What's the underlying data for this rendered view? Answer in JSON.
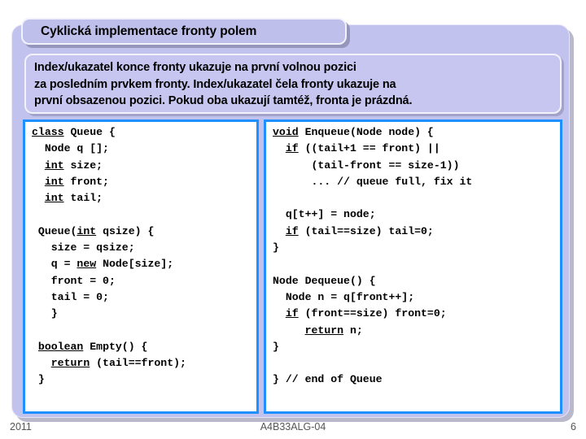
{
  "slide": {
    "title": "Cyklická implementace fronty polem",
    "body": "Index/ukazatel konce fronty ukazuje na první volnou pozici\nza posledním prvkem fronty. Index/ukazatel čela fronty ukazuje na\nprvní obsazenou pozici. Pokud oba ukazují tamtéž, fronta je prázdná."
  },
  "code": {
    "left_lines": [
      {
        "indent": 0,
        "parts": [
          {
            "t": "class",
            "kw": true
          },
          {
            "t": " Queue {",
            "kw": false
          }
        ]
      },
      {
        "indent": 0,
        "parts": [
          {
            "t": "  Node q [];",
            "kw": false
          }
        ]
      },
      {
        "indent": 0,
        "parts": [
          {
            "t": "  ",
            "kw": false
          },
          {
            "t": "int",
            "kw": true
          },
          {
            "t": " size;",
            "kw": false
          }
        ]
      },
      {
        "indent": 0,
        "parts": [
          {
            "t": "  ",
            "kw": false
          },
          {
            "t": "int",
            "kw": true
          },
          {
            "t": " front;",
            "kw": false
          }
        ]
      },
      {
        "indent": 0,
        "parts": [
          {
            "t": "  ",
            "kw": false
          },
          {
            "t": "int",
            "kw": true
          },
          {
            "t": " tail;",
            "kw": false
          }
        ]
      },
      {
        "indent": 0,
        "parts": [
          {
            "t": "",
            "kw": false
          }
        ]
      },
      {
        "indent": 0,
        "parts": [
          {
            "t": " Queue(",
            "kw": false
          },
          {
            "t": "int",
            "kw": true
          },
          {
            "t": " qsize) {",
            "kw": false
          }
        ]
      },
      {
        "indent": 0,
        "parts": [
          {
            "t": "   size = qsize;",
            "kw": false
          }
        ]
      },
      {
        "indent": 0,
        "parts": [
          {
            "t": "   q = ",
            "kw": false
          },
          {
            "t": "new",
            "kw": true
          },
          {
            "t": " Node[size];",
            "kw": false
          }
        ]
      },
      {
        "indent": 0,
        "parts": [
          {
            "t": "   front = 0;",
            "kw": false
          }
        ]
      },
      {
        "indent": 0,
        "parts": [
          {
            "t": "   tail = 0;",
            "kw": false
          }
        ]
      },
      {
        "indent": 0,
        "parts": [
          {
            "t": "   }",
            "kw": false
          }
        ]
      },
      {
        "indent": 0,
        "parts": [
          {
            "t": "",
            "kw": false
          }
        ]
      },
      {
        "indent": 0,
        "parts": [
          {
            "t": " ",
            "kw": false
          },
          {
            "t": "boolean",
            "kw": true
          },
          {
            "t": " Empty() {",
            "kw": false
          }
        ]
      },
      {
        "indent": 0,
        "parts": [
          {
            "t": "   ",
            "kw": false
          },
          {
            "t": "return",
            "kw": true
          },
          {
            "t": " (tail==front);",
            "kw": false
          }
        ]
      },
      {
        "indent": 0,
        "parts": [
          {
            "t": " }",
            "kw": false
          }
        ]
      }
    ],
    "right_lines": [
      {
        "indent": 0,
        "parts": [
          {
            "t": "void",
            "kw": true
          },
          {
            "t": " Enqueue(Node node) {",
            "kw": false
          }
        ]
      },
      {
        "indent": 0,
        "parts": [
          {
            "t": "  ",
            "kw": false
          },
          {
            "t": "if",
            "kw": true
          },
          {
            "t": " ((tail+1 == front) ||",
            "kw": false
          }
        ]
      },
      {
        "indent": 0,
        "parts": [
          {
            "t": "      (tail-front == size-1))",
            "kw": false
          }
        ]
      },
      {
        "indent": 0,
        "parts": [
          {
            "t": "      ... // queue full, fix it",
            "kw": false
          }
        ]
      },
      {
        "indent": 0,
        "parts": [
          {
            "t": "",
            "kw": false
          }
        ]
      },
      {
        "indent": 0,
        "parts": [
          {
            "t": "  q[t++] = node;",
            "kw": false
          }
        ]
      },
      {
        "indent": 0,
        "parts": [
          {
            "t": "  ",
            "kw": false
          },
          {
            "t": "if",
            "kw": true
          },
          {
            "t": " (tail==size) tail=0;",
            "kw": false
          }
        ]
      },
      {
        "indent": 0,
        "parts": [
          {
            "t": "}",
            "kw": false
          }
        ]
      },
      {
        "indent": 0,
        "parts": [
          {
            "t": "",
            "kw": false
          }
        ]
      },
      {
        "indent": 0,
        "parts": [
          {
            "t": "Node Dequeue() {",
            "kw": false
          }
        ]
      },
      {
        "indent": 0,
        "parts": [
          {
            "t": "  Node n = q[front++];",
            "kw": false
          }
        ]
      },
      {
        "indent": 0,
        "parts": [
          {
            "t": "  ",
            "kw": false
          },
          {
            "t": "if",
            "kw": true
          },
          {
            "t": " (front==size) front=0;",
            "kw": false
          }
        ]
      },
      {
        "indent": 0,
        "parts": [
          {
            "t": "     ",
            "kw": false
          },
          {
            "t": "return",
            "kw": true
          },
          {
            "t": " n;",
            "kw": false
          }
        ]
      },
      {
        "indent": 0,
        "parts": [
          {
            "t": "}",
            "kw": false
          }
        ]
      },
      {
        "indent": 0,
        "parts": [
          {
            "t": "",
            "kw": false
          }
        ]
      },
      {
        "indent": 0,
        "parts": [
          {
            "t": "} // end of Queue",
            "kw": false
          }
        ]
      }
    ]
  },
  "footer": {
    "year": "2011",
    "course": "A4B33ALG-04",
    "page": "6"
  },
  "colors": {
    "panel_bg": "#c2c2ee",
    "plate_bg": "#c6c6f0",
    "code_border": "#1e90ff",
    "code_bg": "#ffffff",
    "page_bg": "#ffffff"
  }
}
